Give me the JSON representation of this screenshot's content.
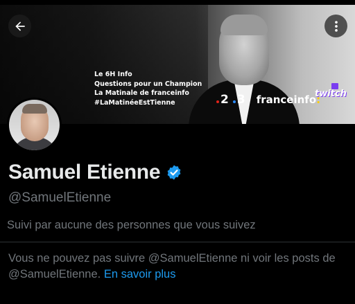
{
  "header": {
    "back_icon": "arrow-left-icon",
    "more_icon": "more-vertical-icon"
  },
  "banner": {
    "lines": [
      "Le 6H Info",
      "Questions pour un Champion",
      "La Matinale de franceinfo",
      "#LaMatinéeEstTienne"
    ],
    "logos": {
      "channel_2": "2",
      "channel_3": "3",
      "franceinfo": "franceinfo",
      "colon": ":",
      "twitch": "twitch"
    }
  },
  "profile": {
    "display_name": "Samuel Etienne",
    "verified": true,
    "verified_icon": "verified-badge-icon",
    "handle": "@SamuelEtienne",
    "followed_by": "Suivi par aucune des personnes que vous suivez",
    "blocked_text": "Vous ne pouvez pas suivre @SamuelEtienne ni voir les posts de @SamuelEtienne.",
    "learn_more": "En savoir plus"
  },
  "colors": {
    "background": "#000000",
    "primary_text": "#e7e9ea",
    "secondary_text": "#71767b",
    "link": "#1d9bf0",
    "verified": "#1d9bf0"
  }
}
